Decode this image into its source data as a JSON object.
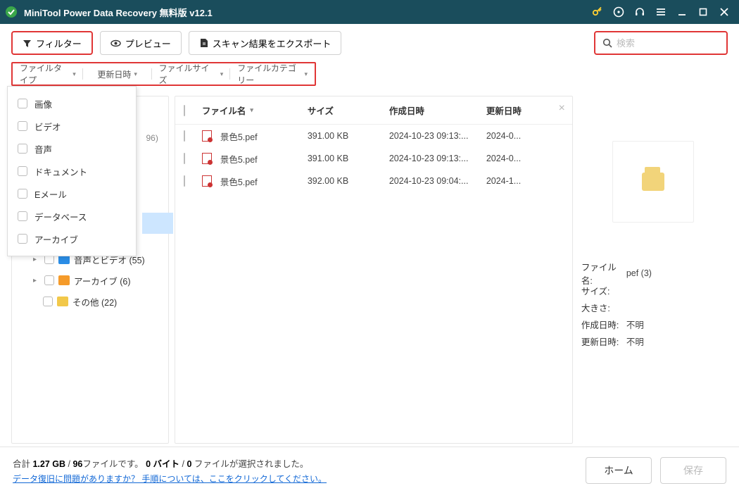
{
  "titlebar": {
    "title": "MiniTool Power Data Recovery 無料版 v12.1"
  },
  "toolbar": {
    "filter": "フィルター",
    "preview": "プレビュー",
    "export": "スキャン結果をエクスポート"
  },
  "search": {
    "placeholder": "検索"
  },
  "filterTabs": {
    "t0": "ファイルタイプ",
    "t1": "更新日時",
    "t2": "ファイルサイズ",
    "t3": "ファイルカテゴリー"
  },
  "dropdown": {
    "i0": "画像",
    "i1": "ビデオ",
    "i2": "音声",
    "i3": "ドキュメント",
    "i4": "Eメール",
    "i5": "データベース",
    "i6": "アーカイブ"
  },
  "tree": {
    "hint": "96)",
    "r0": "音声とビデオ (55)",
    "r1": "アーカイブ (6)",
    "r2": "その他 (22)"
  },
  "table": {
    "h_name": "ファイル名",
    "h_size": "サイズ",
    "h_created": "作成日時",
    "h_mod": "更新日時",
    "rows": [
      {
        "name": "景色5.pef",
        "size": "391.00 KB",
        "created": "2024-10-23 09:13:...",
        "mod": "2024-0..."
      },
      {
        "name": "景色5.pef",
        "size": "391.00 KB",
        "created": "2024-10-23 09:13:...",
        "mod": "2024-0..."
      },
      {
        "name": "景色5.pef",
        "size": "392.00 KB",
        "created": "2024-10-23 09:04:...",
        "mod": "2024-1..."
      }
    ]
  },
  "preview": {
    "k_name": "ファイル名:",
    "v_name": "pef (3)",
    "k_size": "サイズ:",
    "v_size": "",
    "k_dim": "大きさ:",
    "v_dim": "",
    "k_created": "作成日時:",
    "v_created": "不明",
    "k_mod": "更新日時:",
    "v_mod": "不明"
  },
  "footer": {
    "line1_a": "合計 ",
    "line1_b": "1.27 GB",
    "line1_c": " / ",
    "line1_d": "96",
    "line1_e": "ファイルです。 ",
    "line1_f": "0 バイト",
    "line1_g": " / ",
    "line1_h": "0",
    "line1_i": " ファイルが選択されました。",
    "link": "データ復旧に問題がありますか？ 手順については、ここをクリックしてください。",
    "home": "ホーム",
    "save": "保存"
  }
}
